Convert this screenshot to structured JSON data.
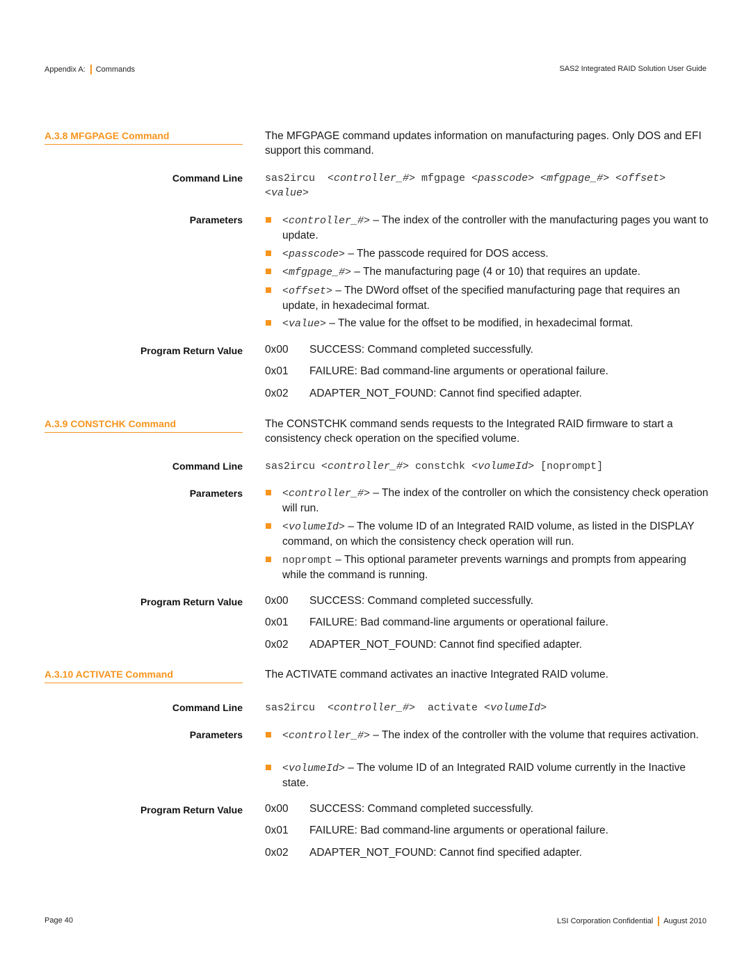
{
  "header": {
    "left_label": "Appendix A:",
    "left_section": "Commands",
    "right_title": "SAS2 Integrated RAID Solution User Guide"
  },
  "footer": {
    "page": "Page 40",
    "confidential": "LSI Corporation Confidential",
    "date": "August 2010"
  },
  "labels": {
    "command_line": "Command Line",
    "parameters": "Parameters",
    "return_value": "Program Return Value"
  },
  "return_codes": [
    {
      "code": "0x00",
      "text": "SUCCESS: Command completed successfully."
    },
    {
      "code": "0x01",
      "text": "FAILURE: Bad command-line arguments or operational failure."
    },
    {
      "code": "0x02",
      "text": "ADAPTER_NOT_FOUND: Cannot find specified adapter."
    }
  ],
  "sections": [
    {
      "title": "A.3.8  MFGPAGE Command",
      "description": "The MFGPAGE command updates information on manufacturing pages. Only DOS and EFI support this command.",
      "command": [
        {
          "t": "sas2ircu  ",
          "i": false
        },
        {
          "t": "<controller_#>",
          "i": true
        },
        {
          "t": " mfgpage ",
          "i": false
        },
        {
          "t": "<passcode>",
          "i": true
        },
        {
          "t": " ",
          "i": false
        },
        {
          "t": "<mfgpage_#>",
          "i": true
        },
        {
          "t": " ",
          "i": false
        },
        {
          "t": "<offset>",
          "i": true
        },
        {
          "t": " ",
          "i": false
        },
        {
          "t": "<value>",
          "i": true
        }
      ],
      "params": [
        {
          "name": "<controller_#>",
          "italic": true,
          "desc": " – The index of the controller with the manufacturing pages you want to update."
        },
        {
          "name": "<passcode>",
          "italic": true,
          "desc": " – The passcode required for DOS access."
        },
        {
          "name": "<mfgpage_#>",
          "italic": true,
          "desc": "  – The manufacturing page (4 or 10) that requires an update."
        },
        {
          "name": "<offset>",
          "italic": true,
          "desc": " – The DWord offset of the specified manufacturing page that requires an update, in hexadecimal format."
        },
        {
          "name": "<value>",
          "italic": true,
          "desc": " – The value for the offset to be modified, in hexadecimal format."
        }
      ]
    },
    {
      "title": "A.3.9  CONSTCHK Command",
      "description": "The CONSTCHK command sends requests to the Integrated RAID firmware to start a consistency check operation on the specified volume.",
      "command": [
        {
          "t": "sas2ircu ",
          "i": false
        },
        {
          "t": "<controller_#>",
          "i": true
        },
        {
          "t": " constchk ",
          "i": false
        },
        {
          "t": "<volumeId>",
          "i": true
        },
        {
          "t": " [noprompt]",
          "i": false
        }
      ],
      "params": [
        {
          "name": "<controller_#>",
          "italic": true,
          "desc": " – The index of the controller on which the consistency check operation will run."
        },
        {
          "name": "<volumeId>",
          "italic": true,
          "desc": " – The volume ID of an Integrated RAID volume, as listed in the DISPLAY command, on which the consistency check operation will run."
        },
        {
          "name": "noprompt",
          "italic": false,
          "desc": " – This optional parameter prevents warnings and prompts from appearing while the command is running."
        }
      ]
    },
    {
      "title": "A.3.10  ACTIVATE Command",
      "description": "The ACTIVATE command activates an inactive Integrated RAID volume.",
      "command": [
        {
          "t": "sas2ircu  ",
          "i": false
        },
        {
          "t": "<controller_#>",
          "i": true
        },
        {
          "t": "  activate ",
          "i": false
        },
        {
          "t": "<volumeId>",
          "i": true
        }
      ],
      "params": [
        {
          "name": "<controller_#>",
          "italic": true,
          "desc": " – The index of the controller with the volume that requires activation."
        },
        {
          "name": "<volumeId>",
          "italic": true,
          "desc": " – The volume ID of an Integrated RAID volume currently in the Inactive state."
        }
      ]
    }
  ]
}
